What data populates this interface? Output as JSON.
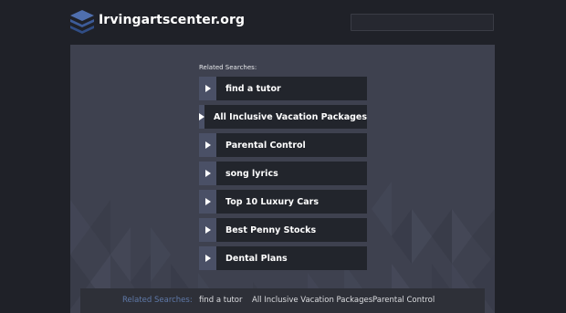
{
  "header": {
    "site_title": "Irvingartscenter.org",
    "logo_icon": "stacked-layers-icon"
  },
  "main": {
    "related_heading": "Related Searches:",
    "results": [
      {
        "label": "find a tutor"
      },
      {
        "label": "All Inclusive Vacation Packages"
      },
      {
        "label": "Parental Control"
      },
      {
        "label": "song lyrics"
      },
      {
        "label": "Top 10 Luxury Cars"
      },
      {
        "label": "Best Penny Stocks"
      },
      {
        "label": "Dental Plans"
      }
    ],
    "arrow_icon": "play-arrow-icon"
  },
  "footer": {
    "label": "Related Searches:",
    "links": [
      "find a tutor",
      "All Inclusive Vacation Packages",
      "Parental Control"
    ]
  },
  "colors": {
    "page_bg": "#1f2128",
    "panel_bg": "#3e414f",
    "result_bg": "#22252c",
    "arrow_bg": "#4a5066",
    "footer_label": "#5f79a8"
  }
}
